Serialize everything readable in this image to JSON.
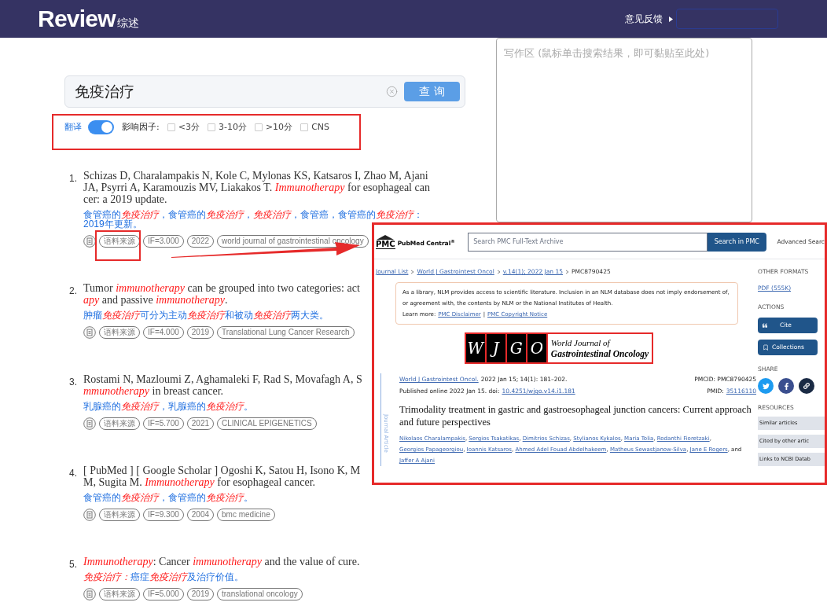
{
  "header": {
    "logo": "Review",
    "logo_subtitle": "综述",
    "feedback": "意见反馈"
  },
  "search": {
    "value": "免疫治疗",
    "button": "查 询"
  },
  "filters": {
    "translate": {
      "label": "翻译",
      "on": true
    },
    "impact_label": "影响因子:",
    "options": [
      {
        "label": "<3分",
        "checked": false
      },
      {
        "label": "3-10分",
        "checked": false
      },
      {
        "label": ">10分",
        "checked": false
      },
      {
        "label": "CNS",
        "checked": false
      }
    ]
  },
  "results": [
    {
      "number": "1.",
      "lines": [
        "Schizas D, Charalampakis N, Kole C, Mylonas KS, Katsaros I, Zhao M, Ajani",
        "JA, Psyrri A, Karamouzis MV, Liakakos T. *Immunotherapy* for esophageal can",
        "cer: a 2019 update."
      ],
      "translation_lines": [
        [
          {
            "text": "食管癌的",
            "highlight": false
          },
          {
            "text": "免疫治疗",
            "highlight": true
          },
          {
            "text": "，食管癌的",
            "highlight": false
          },
          {
            "text": "免疫治疗",
            "highlight": true
          },
          {
            "text": "，",
            "highlight": false
          },
          {
            "text": "免疫治疗",
            "highlight": true
          },
          {
            "text": "，食管癌，食管癌的",
            "highlight": false
          },
          {
            "text": "免疫治疗",
            "highlight": true
          },
          {
            "text": "：",
            "highlight": false
          }
        ],
        [
          {
            "text": "2019年更新。",
            "highlight": false
          }
        ]
      ],
      "tags": [
        "语料来源",
        "IF=3.000",
        "2022",
        "world journal of gastrointestinal oncology"
      ]
    },
    {
      "number": "2.",
      "lines": [
        "Tumor *immunotherapy* can be grouped into two categories: act",
        "*apy* and passive *immunotherapy*."
      ],
      "translation_lines": [
        [
          {
            "text": "肿瘤",
            "highlight": false
          },
          {
            "text": "免疫治疗",
            "highlight": true
          },
          {
            "text": "可分为主动",
            "highlight": false
          },
          {
            "text": "免疫治疗",
            "highlight": true
          },
          {
            "text": "和被动",
            "highlight": false
          },
          {
            "text": "免疫治疗",
            "highlight": true
          },
          {
            "text": "两大类。",
            "highlight": false
          }
        ]
      ],
      "tags": [
        "语料来源",
        "IF=4.000",
        "2019",
        "Translational Lung Cancer Research"
      ]
    },
    {
      "number": "3.",
      "lines": [
        "Rostami N, Mazloumi Z, Aghamaleki F, Rad S, Movafagh A, S",
        "*mmunotherapy* in breast cancer."
      ],
      "translation_lines": [
        [
          {
            "text": "乳腺癌的",
            "highlight": false
          },
          {
            "text": "免疫治疗",
            "highlight": true
          },
          {
            "text": "，乳腺癌的",
            "highlight": false
          },
          {
            "text": "免疫治疗",
            "highlight": true
          },
          {
            "text": "。",
            "highlight": false
          }
        ]
      ],
      "tags": [
        "语料来源",
        "IF=5.700",
        "2021",
        "CLINICAL EPIGENETICS"
      ]
    },
    {
      "number": "4.",
      "lines": [
        "[ PubMed ] [ Google Scholar ] Ogoshi K, Satou H, Isono K, M",
        "M, Sugita M. *Immunotherapy* for esophageal cancer."
      ],
      "translation_lines": [
        [
          {
            "text": "食管癌的",
            "highlight": false
          },
          {
            "text": "免疫治疗",
            "highlight": true
          },
          {
            "text": "，食管癌的",
            "highlight": false
          },
          {
            "text": "免疫治疗",
            "highlight": true
          },
          {
            "text": "。",
            "highlight": false
          }
        ]
      ],
      "tags": [
        "语料来源",
        "IF=9.300",
        "2004",
        "bmc medicine"
      ]
    },
    {
      "number": "5.",
      "lines": [
        "*Immunotherapy*: Cancer *immunotherapy* and the value of cure."
      ],
      "translation_lines": [
        [
          {
            "text": "免疫治疗：",
            "highlight": true
          },
          {
            "text": "癌症",
            "highlight": false
          },
          {
            "text": "免疫治疗",
            "highlight": true
          },
          {
            "text": "及治疗价值。",
            "highlight": false
          }
        ]
      ],
      "tags": [
        "语料来源",
        "IF=5.000",
        "2019",
        "translational oncology"
      ]
    }
  ],
  "writing_area": {
    "placeholder": "写作区 (鼠标单击搜索结果，即可黏贴至此处)"
  },
  "pmc": {
    "logo_mark": "PMC",
    "logo_text": "PubMed Central$^{®}$",
    "search_placeholder": "Search PMC Full-Text Archive",
    "search_button": "Search in PMC",
    "advanced_link": "Advanced Searc",
    "breadcrumb": [
      {
        "label": "Journal List",
        "link": true
      },
      {
        "label": "World J Gastrointest Oncol",
        "link": true
      },
      {
        "label": "v.14(1); 2022 Jan 15",
        "link": true
      },
      {
        "label": "PMC8790425",
        "link": false
      }
    ],
    "notice": {
      "text": "As a library, NLM provides access to scientific literature. Inclusion in an NLM database does not imply endorsement of, or agreement with, the contents by NLM or the National Institutes of Health.",
      "learn_more": "Learn more:",
      "links": [
        "PMC Disclaimer",
        "PMC Copyright Notice"
      ],
      "separator": "|"
    },
    "journal_logo": {
      "letters": [
        "W",
        "J",
        "G",
        "O"
      ],
      "line1": "World Journal of",
      "line2": "Gastrointestinal Oncology"
    },
    "side_tab": "Journal Article",
    "citation": {
      "journal": "World J Gastrointest Oncol.",
      "details": "2022 Jan 15; 14(1): 181–202.",
      "published": "Published online 2022 Jan 15. doi:",
      "doi": "10.4251/wjgo.v14.i1.181",
      "pmcid": "PMCID: PMC8790425",
      "pmid_label": "PMID:",
      "pmid": "35116110"
    },
    "title": "Trimodality treatment in gastric and gastroesophageal junction cancers: Current approach and future perspectives",
    "authors": [
      {
        "name": "Nikolaos Charalampakis",
        "after": ","
      },
      {
        "name": "Sergios Tsakatikas",
        "after": ","
      },
      {
        "name": "Dimitrios Schizas",
        "after": ","
      },
      {
        "name": "Stylianos Kykalos",
        "after": ","
      },
      {
        "name": "Maria Tolia",
        "after": ","
      },
      {
        "name": "Rodanthi Fioretzaki",
        "after": ","
      },
      {
        "name": "Georgios Papageorgiou",
        "after": ","
      },
      {
        "name": "Ioannis Katsaros",
        "after": ","
      },
      {
        "name": "Ahmed Adel Fouad Abdelhakeem",
        "after": ","
      },
      {
        "name": "Matheus Sewastjanow-Silva",
        "after": ","
      },
      {
        "name": "Jane E Rogers",
        "after": ", and"
      },
      {
        "name": "Jaffer A Ajani"
      }
    ],
    "sidebar": {
      "other_formats": "OTHER FORMATS",
      "pdf": "PDF (555K)",
      "actions": "ACTIONS",
      "buttons": [
        {
          "kind": "cite",
          "label": "Cite"
        },
        {
          "kind": "collections",
          "label": "Collections"
        }
      ],
      "share": "SHARE",
      "share_icons": [
        {
          "kind": "twitter"
        },
        {
          "kind": "facebook"
        },
        {
          "kind": "link"
        }
      ],
      "resources": "RESOURCES",
      "resource_items": [
        "Similar articles",
        "Cited by other artic",
        "Links to NCBI Datab"
      ]
    }
  }
}
